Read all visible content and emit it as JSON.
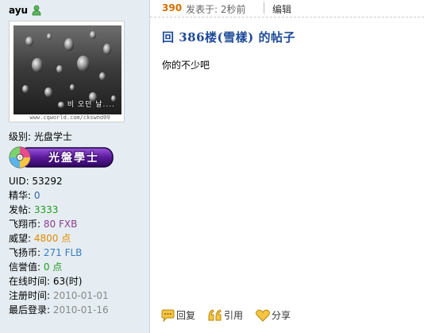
{
  "user": {
    "name": "ayu",
    "avatar_caption": "비 오던 날....",
    "avatar_watermark": "www.cqworld.com/ckswnd09",
    "level_label": "级别: 光盘学士",
    "level_badge_text": "光盤學士",
    "icons": {
      "online": "online-user-icon",
      "badge": "cd-disc-icon"
    },
    "stats": [
      {
        "label": "UID: ",
        "value": "53292"
      },
      {
        "label": "精华: ",
        "value": "0"
      },
      {
        "label": "发帖: ",
        "value": "3333"
      },
      {
        "label": "飞翔币: ",
        "value": "80 FXB"
      },
      {
        "label": "威望: ",
        "value": "4800 点"
      },
      {
        "label": "飞扬币: ",
        "value": "271 FLB"
      },
      {
        "label": "信誉值: ",
        "value": "0 点"
      },
      {
        "label": "在线时间: ",
        "value": "63(时)"
      },
      {
        "label": "注册时间: ",
        "value": "2010-01-01"
      },
      {
        "label": "最后登录: ",
        "value": "2010-01-16"
      }
    ]
  },
  "post": {
    "floor": "390",
    "time_text": "发表于: 2秒前",
    "edit_label": "编辑",
    "title": "回 386楼(雪樣) 的帖子",
    "body": "你的不少吧",
    "actions": [
      {
        "label": "回复",
        "icon": "reply-icon"
      },
      {
        "label": "引用",
        "icon": "quote-icon"
      },
      {
        "label": "分享",
        "icon": "heart-icon"
      }
    ]
  },
  "colors": {
    "sidebar_bg": "#e5edf2",
    "title": "#1f4b99",
    "floor": "#d46f00",
    "badge_purple": "#5b1a9a"
  }
}
